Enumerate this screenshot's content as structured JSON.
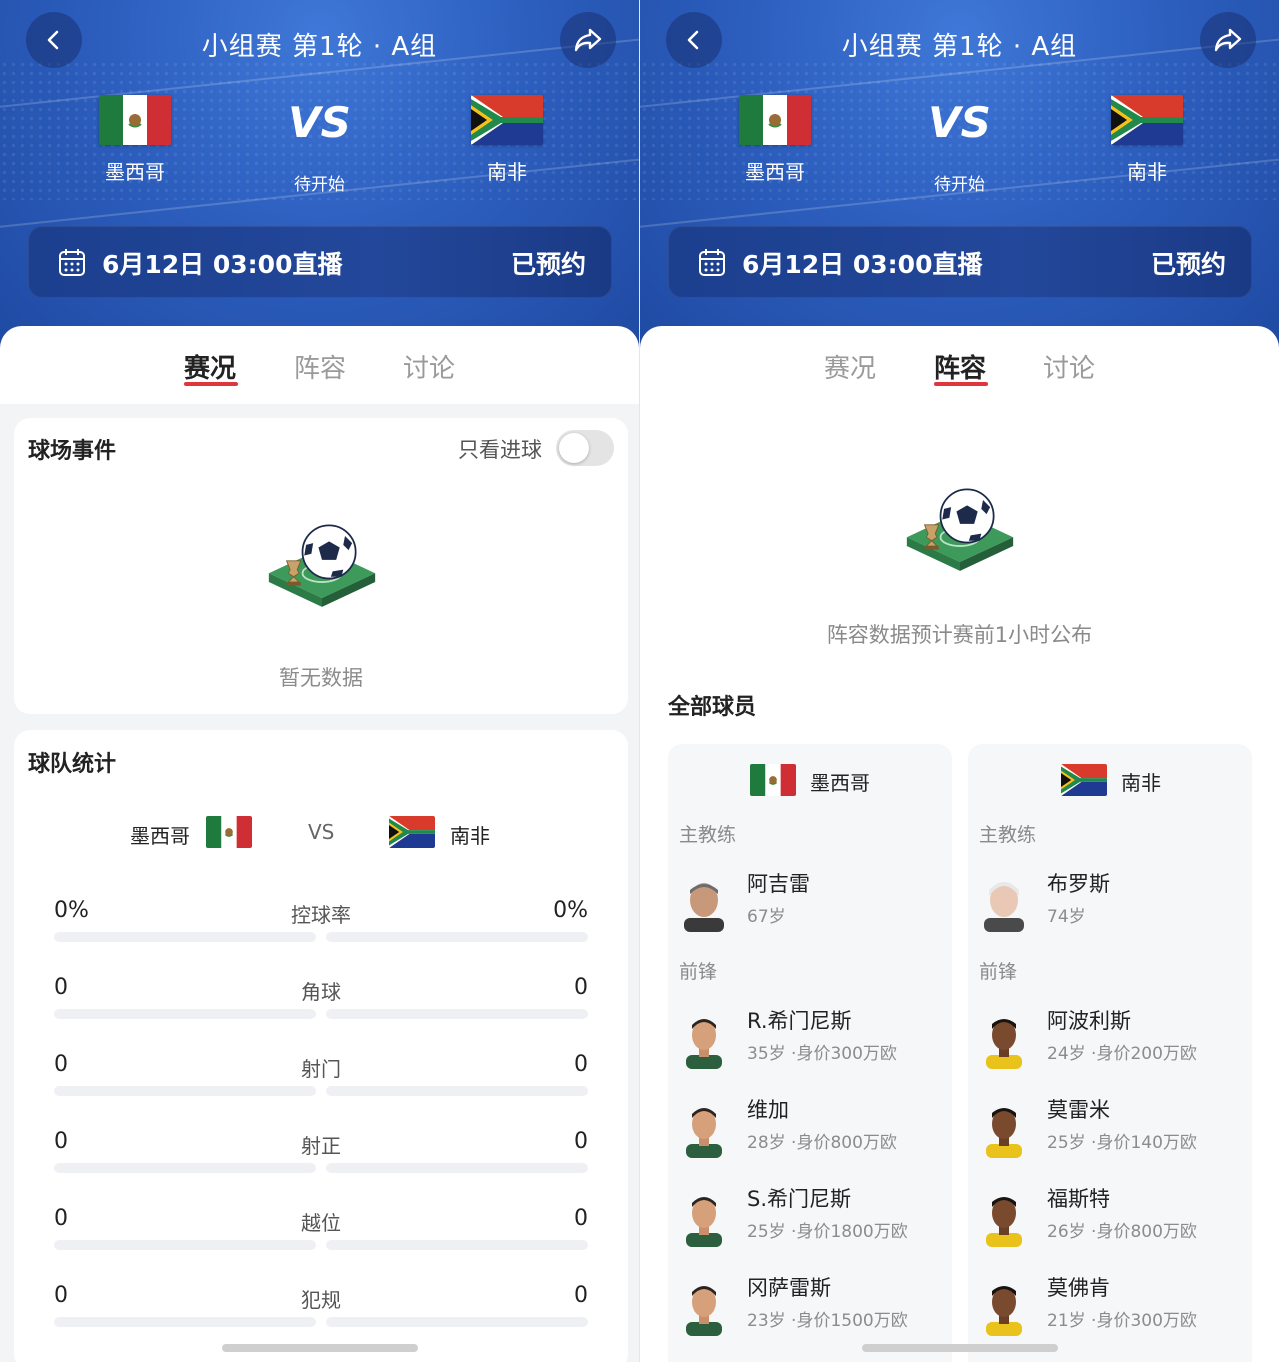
{
  "header": {
    "title": "小组赛 第1轮 · A组",
    "vs": "VS",
    "status": "待开始",
    "home_team": "墨西哥",
    "away_team": "南非",
    "live_time": "6月12日 03:00直播",
    "reserve_label": "已预约"
  },
  "tabs": [
    "赛况",
    "阵容",
    "讨论"
  ],
  "left_panel": {
    "active_tab": "赛况",
    "events": {
      "title": "球场事件",
      "toggle_label": "只看进球",
      "toggle_on": false,
      "empty_text": "暂无数据"
    },
    "team_stats": {
      "title": "球队统计",
      "home": "墨西哥",
      "vs": "VS",
      "away": "南非",
      "rows": [
        {
          "label": "控球率",
          "home": "0%",
          "away": "0%"
        },
        {
          "label": "角球",
          "home": "0",
          "away": "0"
        },
        {
          "label": "射门",
          "home": "0",
          "away": "0"
        },
        {
          "label": "射正",
          "home": "0",
          "away": "0"
        },
        {
          "label": "越位",
          "home": "0",
          "away": "0"
        },
        {
          "label": "犯规",
          "home": "0",
          "away": "0"
        }
      ]
    }
  },
  "right_panel": {
    "active_tab": "阵容",
    "notice": "阵容数据预计赛前1小时公布",
    "all_players_title": "全部球员",
    "home": {
      "team": "墨西哥",
      "coach_label": "主教练",
      "coach": {
        "name": "阿吉雷",
        "meta": "67岁"
      },
      "forward_label": "前锋",
      "forwards": [
        {
          "name": "R.希门尼斯",
          "meta": "35岁 ·身价300万欧"
        },
        {
          "name": "维加",
          "meta": "28岁 ·身价800万欧"
        },
        {
          "name": "S.希门尼斯",
          "meta": "25岁 ·身价1800万欧"
        },
        {
          "name": "冈萨雷斯",
          "meta": "23岁 ·身价1500万欧"
        }
      ]
    },
    "away": {
      "team": "南非",
      "coach_label": "主教练",
      "coach": {
        "name": "布罗斯",
        "meta": "74岁"
      },
      "forward_label": "前锋",
      "forwards": [
        {
          "name": "阿波利斯",
          "meta": "24岁 ·身价200万欧"
        },
        {
          "name": "莫雷米",
          "meta": "25岁 ·身价140万欧"
        },
        {
          "name": "福斯特",
          "meta": "26岁 ·身价800万欧"
        },
        {
          "name": "莫佛肯",
          "meta": "21岁 ·身价300万欧"
        }
      ]
    }
  },
  "colors": {
    "accent": "#e0343f",
    "hero_blue": "#2d5fbf"
  },
  "icons": [
    "back-arrow-icon",
    "share-icon",
    "calendar-icon",
    "trophy-ball-icon",
    "mexico-flag-icon",
    "south-africa-flag-icon"
  ]
}
